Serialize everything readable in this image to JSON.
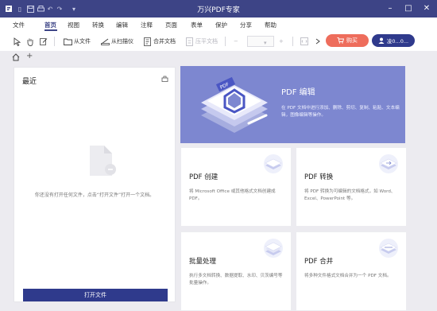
{
  "app": {
    "title": "万兴PDF专家",
    "colors": {
      "accent": "#3d4486",
      "buy": "#ee6d5c",
      "hero": "#7d87d0",
      "button": "#2f3a8c"
    }
  },
  "menu": {
    "items": [
      "文件",
      "首页",
      "视图",
      "转换",
      "编辑",
      "注释",
      "页面",
      "表单",
      "保护",
      "分享",
      "帮助"
    ],
    "active": "首页"
  },
  "toolbar": {
    "from_file": "从文件",
    "from_scanner": "从扫描仪",
    "merge_docs": "合并文档",
    "compress_docs": "压平文档",
    "zoom_minus": "−",
    "zoom_plus": "+",
    "buy_label": "购买",
    "user_label": "凌0...0..."
  },
  "tabs": {
    "home_icon": "home-icon",
    "add_label": "+"
  },
  "recent": {
    "title": "最近",
    "empty_message": "你还没有打开任何文件，点击“打开文件”打开一个文档。",
    "open_button": "打开文件"
  },
  "hero": {
    "title": "PDF 编辑",
    "description": "在 PDF 文档中进行添加、删除、剪切、复制、粘贴、文本编辑，图像编辑等操作。"
  },
  "cards": [
    {
      "title": "PDF 创建",
      "description": "将 Microsoft Office 或其他格式文档创建成 PDF。"
    },
    {
      "title": "PDF 转换",
      "description": "将 PDF 转换为可编辑的文档格式，如 Word、Excel、PowerPoint 等。"
    },
    {
      "title": "批量处理",
      "description": "执行多文档转换、数据提取、水印、贝茨编号等批量操作。"
    },
    {
      "title": "PDF 合并",
      "description": "将多种文件格式文档合并为一个 PDF 文档。"
    }
  ]
}
